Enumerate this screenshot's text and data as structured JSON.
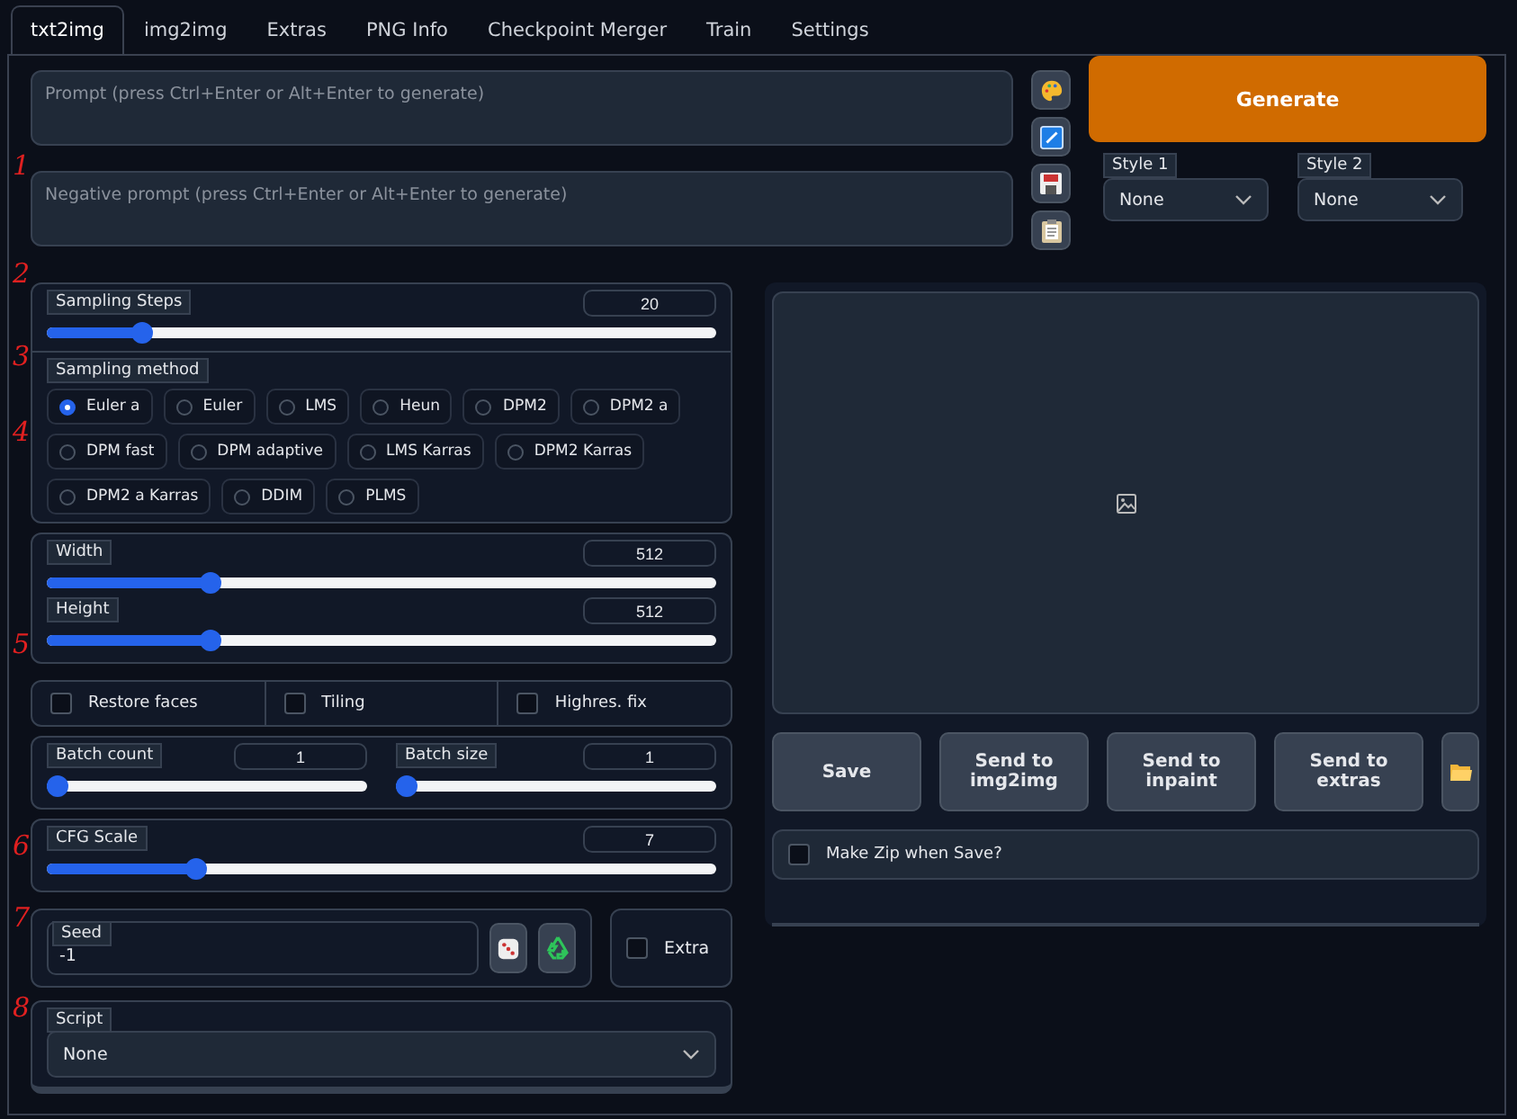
{
  "tabs": [
    {
      "label": "txt2img",
      "selected": true
    },
    {
      "label": "img2img",
      "selected": false
    },
    {
      "label": "Extras",
      "selected": false
    },
    {
      "label": "PNG Info",
      "selected": false
    },
    {
      "label": "Checkpoint Merger",
      "selected": false
    },
    {
      "label": "Train",
      "selected": false
    },
    {
      "label": "Settings",
      "selected": false
    }
  ],
  "prompt": {
    "placeholder": "Prompt (press Ctrl+Enter or Alt+Enter to generate)"
  },
  "negative_prompt": {
    "placeholder": "Negative prompt (press Ctrl+Enter or Alt+Enter to generate)"
  },
  "tool_buttons": [
    {
      "kind": "palette"
    },
    {
      "kind": "check"
    },
    {
      "kind": "save"
    },
    {
      "kind": "clipboard"
    }
  ],
  "generate_button": "Generate",
  "styles": [
    {
      "label": "Style 1",
      "value": "None"
    },
    {
      "label": "Style 2",
      "value": "None"
    }
  ],
  "sampling_steps": {
    "label": "Sampling Steps",
    "value": "20",
    "level": 0.13
  },
  "sampling_method": {
    "label": "Sampling method",
    "options": [
      {
        "label": "Euler a",
        "selected": true
      },
      {
        "label": "Euler",
        "selected": false
      },
      {
        "label": "LMS",
        "selected": false
      },
      {
        "label": "Heun",
        "selected": false
      },
      {
        "label": "DPM2",
        "selected": false
      },
      {
        "label": "DPM2 a",
        "selected": false
      },
      {
        "label": "DPM fast",
        "selected": false
      },
      {
        "label": "DPM adaptive",
        "selected": false
      },
      {
        "label": "LMS Karras",
        "selected": false
      },
      {
        "label": "DPM2 Karras",
        "selected": false
      },
      {
        "label": "DPM2 a Karras",
        "selected": false
      },
      {
        "label": "DDIM",
        "selected": false
      },
      {
        "label": "PLMS",
        "selected": false
      }
    ]
  },
  "size_sliders": [
    {
      "label": "Width",
      "value": "512",
      "level": 0.235
    },
    {
      "label": "Height",
      "value": "512",
      "level": 0.235
    }
  ],
  "options": [
    {
      "label": "Restore faces",
      "checked": false
    },
    {
      "label": "Tiling",
      "checked": false
    },
    {
      "label": "Highres. fix",
      "checked": false
    }
  ],
  "batch_sliders": [
    {
      "label": "Batch count",
      "value": "1",
      "level": 0
    },
    {
      "label": "Batch size",
      "value": "1",
      "level": 0
    }
  ],
  "cfg_scale": {
    "label": "CFG Scale",
    "value": "7",
    "level": 0.215
  },
  "seed": {
    "label": "Seed",
    "value": "-1",
    "extra": {
      "label": "Extra",
      "checked": false
    }
  },
  "script": {
    "label": "Script",
    "value": "None"
  },
  "output_buttons": [
    {
      "label": "Save"
    },
    {
      "label": "Send to img2img"
    },
    {
      "label": "Send to inpaint"
    },
    {
      "label": "Send to extras"
    }
  ],
  "make_zip": {
    "label": "Make Zip when Save?",
    "checked": false
  },
  "annotation_marks": [
    "1",
    "2",
    "3",
    "4",
    "5",
    "6",
    "7",
    "8"
  ]
}
